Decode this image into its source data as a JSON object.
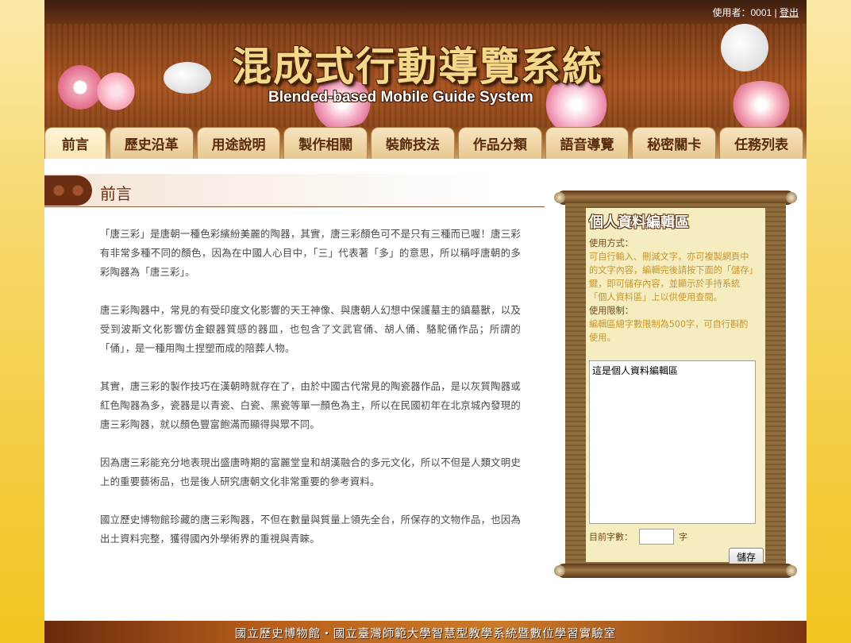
{
  "user_bar": {
    "user_label": "使用者：0001",
    "separator": "|",
    "logout_label": "登出"
  },
  "banner": {
    "title": "混成式行動導覽系統",
    "subtitle": "Blended-based Mobile Guide System"
  },
  "nav": {
    "tabs": [
      {
        "label": "前言",
        "active": true
      },
      {
        "label": "歷史沿革"
      },
      {
        "label": "用途說明"
      },
      {
        "label": "製作相關"
      },
      {
        "label": "裝飾技法"
      },
      {
        "label": "作品分類"
      },
      {
        "label": "語音導覽"
      },
      {
        "label": "秘密關卡"
      },
      {
        "label": "任務列表"
      }
    ]
  },
  "section": {
    "title": "前言"
  },
  "article": {
    "paragraphs": [
      "「唐三彩」是唐朝一種色彩繽紛美麗的陶器，其實，唐三彩顏色可不是只有三種而已喔！唐三彩有非常多種不同的顏色，因為在中國人心目中，「三」代表著「多」的意思，所以稱呼唐朝的多彩陶器為「唐三彩」。",
      "唐三彩陶器中，常見的有受印度文化影響的天王神像、與唐朝人幻想中保護墓主的鎮墓獸，以及受到波斯文化影響仿金銀器質感的器皿，也包含了文武官俑、胡人俑、駱駝俑作品；所謂的「俑」，是一種用陶土捏塑而成的陪葬人物。",
      "其實，唐三彩的製作技巧在漢朝時就存在了，由於中國古代常見的陶瓷器作品，是以灰質陶器或紅色陶器為多，瓷器是以青瓷、白瓷、黑瓷等單一顏色為主，所以在民國初年在北京城內發現的唐三彩陶器，就以顏色豐富飽滿而顯得與眾不同。",
      "因為唐三彩能充分地表現出盛唐時期的富麗堂皇和胡漢融合的多元文化，所以不但是人類文明史上的重要藝術品，也是後人研究唐朝文化非常重要的參考資料。",
      "國立歷史博物館珍藏的唐三彩陶器，不但在數量與質量上領先全台，所保存的文物作品，也因為出土資料完整，獲得國內外學術界的重視與青睞。"
    ]
  },
  "profile_panel": {
    "title": "個人資料編輯區",
    "usage_label": "使用方式：",
    "usage_desc": "可自行輸入、刪減文字，亦可複製網頁中的文字內容，編輯完後請按下面的「儲存」鍵，即可儲存內容，並顯示於手持系統「個人資料區」上以供使用查閱。",
    "limit_label": "使用限制：",
    "limit_desc": "編輯區總字數限制為500字，可自行斟酌使用。",
    "textarea_value": "這是個人資料編輯區",
    "count_label": "目前字數：",
    "count_value": "",
    "count_unit": "字",
    "save_label": "儲存"
  },
  "footer": {
    "text": "國立歷史博物館・國立臺灣師範大學智慧型教學系統暨數位學習實驗室"
  },
  "colors": {
    "brand_brown": "#6b2e12",
    "panel_paper": "#f5ecc0",
    "panel_desc": "#c8962a"
  }
}
